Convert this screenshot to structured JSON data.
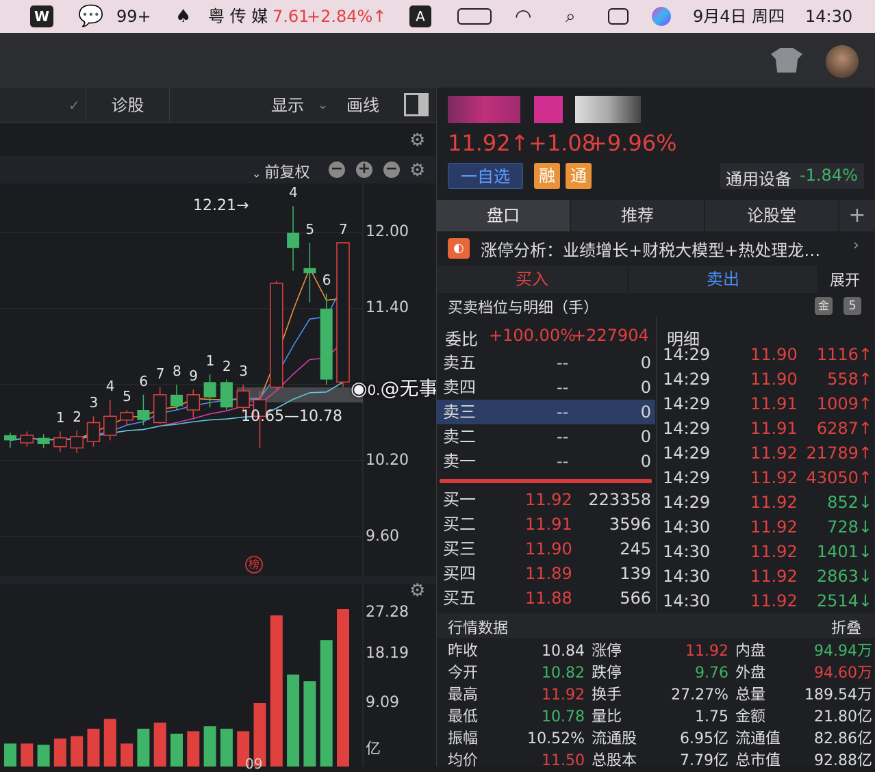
{
  "menubar": {
    "wps": "W",
    "wechat_count": "99+",
    "stock_name": "粤 传 媒",
    "stock_price": "7.61",
    "stock_change": "+2.84%↑",
    "input_label": "A",
    "date": "9月4日 周四",
    "time": "14:30"
  },
  "toolbar": {
    "diagnose": "诊股",
    "display": "显示",
    "draw": "画线",
    "adjust": "前复权"
  },
  "chart": {
    "y_ticks": [
      "12.00",
      "11.40",
      "10.20",
      "9.60"
    ],
    "vol_ticks": [
      "27.28",
      "18.19",
      "9.09",
      "亿"
    ],
    "x_tick": "09",
    "high_label": "12.21→",
    "range_label": "10.65—10.78",
    "board_label": "榜",
    "watermark": "@无事小正经",
    "watermark_prefix": "0.",
    "badge_9": "9",
    "candle_labels": [
      "1",
      "2",
      "3",
      "4",
      "5",
      "6",
      "7",
      "8",
      "9",
      "1",
      "2",
      "3",
      "4",
      "5",
      "6",
      "7"
    ]
  },
  "chart_data": {
    "type": "candlestick",
    "ylim": [
      9.6,
      12.25
    ],
    "values": [
      {
        "o": 10.4,
        "c": 10.36,
        "h": 10.42,
        "l": 10.3
      },
      {
        "o": 10.34,
        "c": 10.4,
        "h": 10.43,
        "l": 10.31
      },
      {
        "o": 10.38,
        "c": 10.33,
        "h": 10.41,
        "l": 10.3
      },
      {
        "o": 10.31,
        "c": 10.38,
        "h": 10.43,
        "l": 10.27
      },
      {
        "o": 10.3,
        "c": 10.39,
        "h": 10.44,
        "l": 10.26
      },
      {
        "o": 10.35,
        "c": 10.5,
        "h": 10.55,
        "l": 10.31
      },
      {
        "o": 10.4,
        "c": 10.55,
        "h": 10.68,
        "l": 10.36
      },
      {
        "o": 10.52,
        "c": 10.58,
        "h": 10.6,
        "l": 10.48
      },
      {
        "o": 10.6,
        "c": 10.52,
        "h": 10.72,
        "l": 10.48
      },
      {
        "o": 10.5,
        "c": 10.72,
        "h": 10.78,
        "l": 10.49
      },
      {
        "o": 10.72,
        "c": 10.63,
        "h": 10.8,
        "l": 10.6
      },
      {
        "o": 10.6,
        "c": 10.72,
        "h": 10.76,
        "l": 10.54
      },
      {
        "o": 10.82,
        "c": 10.7,
        "h": 10.88,
        "l": 10.62
      },
      {
        "o": 10.82,
        "c": 10.62,
        "h": 10.84,
        "l": 10.6
      },
      {
        "o": 10.62,
        "c": 10.75,
        "h": 10.8,
        "l": 10.58
      },
      {
        "o": 10.55,
        "c": 10.68,
        "h": 10.75,
        "l": 10.3
      },
      {
        "o": 10.78,
        "c": 11.6,
        "h": 11.62,
        "l": 10.75
      },
      {
        "o": 12.0,
        "c": 11.88,
        "h": 12.21,
        "l": 11.7
      },
      {
        "o": 11.72,
        "c": 11.68,
        "h": 11.92,
        "l": 11.45
      },
      {
        "o": 11.4,
        "c": 10.84,
        "h": 11.52,
        "l": 10.8
      },
      {
        "o": 10.82,
        "c": 11.92,
        "h": 11.92,
        "l": 10.78
      }
    ]
  },
  "right": {
    "price": "11.92↑",
    "change": "+1.08",
    "pct": "+9.96%",
    "watch": "一自选",
    "rong": "融",
    "tong": "通",
    "sector": "通用设备",
    "sector_pct": "-1.84%",
    "tabs": [
      "盘口",
      "推荐",
      "论股堂",
      "+"
    ],
    "limit_up": "涨停分析：业绩增长+财税大模型+热处理龙…",
    "buy": "买入",
    "sell": "卖出",
    "expand": "展开",
    "order_title": "买卖档位与明细（手）",
    "level": "5",
    "weibi_label": "委比",
    "weibi_pct": "+100.00%",
    "weibi_num": "+227904",
    "detail_title": "明细",
    "asks": [
      {
        "l": "卖五",
        "p": "--",
        "v": "0"
      },
      {
        "l": "卖四",
        "p": "--",
        "v": "0"
      },
      {
        "l": "卖三",
        "p": "--",
        "v": "0"
      },
      {
        "l": "卖二",
        "p": "--",
        "v": "0"
      },
      {
        "l": "卖一",
        "p": "--",
        "v": "0"
      }
    ],
    "bids": [
      {
        "l": "买一",
        "p": "11.92",
        "v": "223358"
      },
      {
        "l": "买二",
        "p": "11.91",
        "v": "3596"
      },
      {
        "l": "买三",
        "p": "11.90",
        "v": "245"
      },
      {
        "l": "买四",
        "p": "11.89",
        "v": "139"
      },
      {
        "l": "买五",
        "p": "11.88",
        "v": "566"
      }
    ],
    "details": [
      {
        "t": "14:29",
        "p": "11.90",
        "v": "1116↑"
      },
      {
        "t": "14:29",
        "p": "11.90",
        "v": "558↑"
      },
      {
        "t": "14:29",
        "p": "11.91",
        "v": "1009↑"
      },
      {
        "t": "14:29",
        "p": "11.91",
        "v": "6287↑"
      },
      {
        "t": "14:29",
        "p": "11.92",
        "v": "21789↑"
      },
      {
        "t": "14:29",
        "p": "11.92",
        "v": "43050↑"
      },
      {
        "t": "14:29",
        "p": "11.92",
        "v": "852↓"
      },
      {
        "t": "14:30",
        "p": "11.92",
        "v": "728↓"
      },
      {
        "t": "14:30",
        "p": "11.92",
        "v": "1401↓"
      },
      {
        "t": "14:30",
        "p": "11.92",
        "v": "2863↓"
      },
      {
        "t": "14:30",
        "p": "11.92",
        "v": "2514↓"
      }
    ],
    "quote_title": "行情数据",
    "fold": "折叠",
    "quotes": [
      [
        "昨收",
        "10.84",
        "涨停",
        "11.92",
        "内盘",
        "94.94万"
      ],
      [
        "今开",
        "10.82",
        "跌停",
        "9.76",
        "外盘",
        "94.60万"
      ],
      [
        "最高",
        "11.92",
        "换手",
        "27.27%",
        "总量",
        "189.54万"
      ],
      [
        "最低",
        "10.78",
        "量比",
        "1.75",
        "金额",
        "21.80亿"
      ],
      [
        "振幅",
        "10.52%",
        "流通股",
        "6.95亿",
        "流通值",
        "82.86亿"
      ],
      [
        "均价",
        "11.50",
        "总股本",
        "7.79亿",
        "总市值",
        "92.88亿"
      ]
    ]
  },
  "colors": {
    "up": "#e0413f",
    "down": "#3fb466",
    "accent": "#4a8cf5",
    "orange": "#e8933a"
  }
}
